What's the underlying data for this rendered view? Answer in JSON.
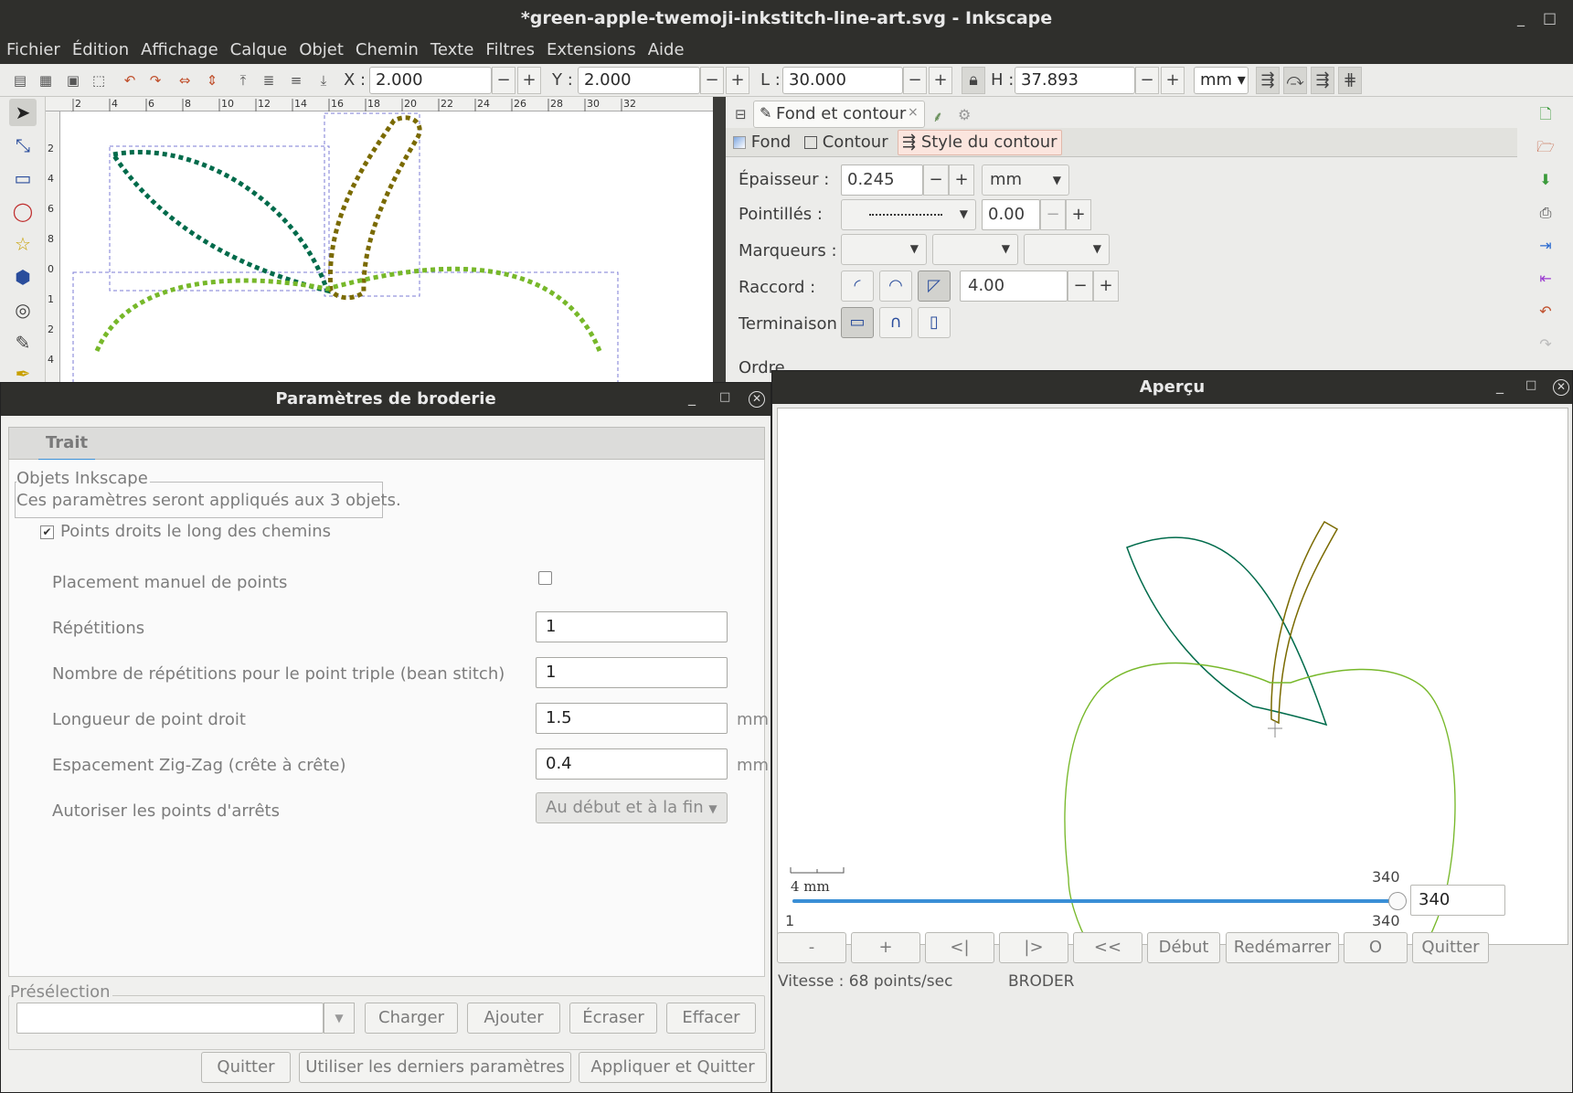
{
  "window": {
    "title": "*green-apple-twemoji-inkstitch-line-art.svg - Inkscape",
    "minimize": "_",
    "maximize": "□",
    "close": "✕"
  },
  "menu": [
    "Fichier",
    "Édition",
    "Affichage",
    "Calque",
    "Objet",
    "Chemin",
    "Texte",
    "Filtres",
    "Extensions",
    "Aide"
  ],
  "toolbar": {
    "x_label": "X :",
    "x_value": "2.000",
    "y_label": "Y :",
    "y_value": "2.000",
    "w_label": "L :",
    "w_value": "30.000",
    "h_label": "H :",
    "h_value": "37.893",
    "unit": "mm",
    "minus": "−",
    "plus": "+"
  },
  "ruler": {
    "ticks": [
      "2",
      "4",
      "6",
      "8",
      "10",
      "12",
      "14",
      "16",
      "18",
      "20",
      "22",
      "24",
      "26",
      "28",
      "30",
      "32"
    ],
    "left_ticks": [
      "2",
      "4",
      "6",
      "8",
      "0",
      "1",
      "2",
      "4"
    ]
  },
  "fill_stroke": {
    "panel_title": "Fond et contour",
    "close": "×",
    "tabs": [
      "Fond",
      "Contour",
      "Style du contour"
    ],
    "active_tab": "Style du contour",
    "width_label": "Épaisseur :",
    "width_value": "0.245",
    "width_unit": "mm",
    "dashes_label": "Pointillés :",
    "dash_offset": "0.00",
    "markers_label": "Marqueurs :",
    "join_label": "Raccord :",
    "miter_value": "4.00",
    "cap_label": "Terminaison :",
    "order_label": "Ordre"
  },
  "embroidery_dialog": {
    "title": "Paramètres de broderie",
    "tab": "Trait",
    "group_title": "Objets Inkscape",
    "group_text": "Ces paramètres seront appliqués aux 3 objets.",
    "running_stitch_label": "Points droits le long des chemins",
    "running_stitch_checked": true,
    "params": [
      {
        "label": "Placement manuel de points",
        "type": "checkbox",
        "value": ""
      },
      {
        "label": "Répétitions",
        "type": "entry",
        "value": "1",
        "unit": ""
      },
      {
        "label": "Nombre de répétitions pour le point triple (bean stitch)",
        "type": "entry",
        "value": "1",
        "unit": ""
      },
      {
        "label": "Longueur de point droit",
        "type": "entry",
        "value": "1.5",
        "unit": "mm"
      },
      {
        "label": "Espacement Zig-Zag (crête à crête)",
        "type": "entry",
        "value": "0.4",
        "unit": "mm"
      },
      {
        "label": "Autoriser les points d'arrêts",
        "type": "select",
        "value": "Au début et à la fin",
        "unit": ""
      }
    ],
    "preset_label": "Présélection",
    "preset_value": "",
    "preset_buttons": [
      "Charger",
      "Ajouter",
      "Écraser",
      "Effacer"
    ],
    "footer_buttons": [
      "Quitter",
      "Utiliser les derniers paramètres",
      "Appliquer et Quitter"
    ]
  },
  "preview": {
    "title": "Aperçu",
    "scale_label": "4  mm",
    "slider_min": "1",
    "slider_max": "340",
    "slider_value_top": "340",
    "slider_value_bottom": "340",
    "slider_fraction": 1.0,
    "stitch_value": "340",
    "buttons": [
      "-",
      "+",
      "<|",
      "|>",
      "<<",
      "Début",
      "Redémarrer",
      "O",
      "Quitter"
    ],
    "status_speed": "Vitesse : 68 points/sec",
    "status_mode": "BRODER"
  },
  "colors": {
    "leaf": "#006b4b",
    "stem": "#7a6a00",
    "apple": "#77b82a",
    "accent": "#3a8fd6"
  }
}
